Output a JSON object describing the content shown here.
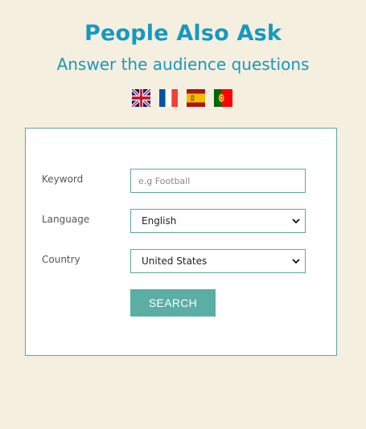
{
  "header": {
    "title": "People Also Ask",
    "subtitle": "Answer the audience questions"
  },
  "flags": [
    {
      "name": "uk-flag-icon",
      "country": "United Kingdom"
    },
    {
      "name": "france-flag-icon",
      "country": "France"
    },
    {
      "name": "spain-flag-icon",
      "country": "Spain"
    },
    {
      "name": "portugal-flag-icon",
      "country": "Portugal"
    }
  ],
  "form": {
    "keyword_label": "Keyword",
    "keyword_placeholder": "e.g Football",
    "language_label": "Language",
    "language_value": "English",
    "country_label": "Country",
    "country_value": "United States",
    "search_label": "SEARCH"
  },
  "colors": {
    "background": "#f5efe0",
    "brand": "#1799bd",
    "accent": "#5aaea4",
    "border": "#5fa89a"
  }
}
